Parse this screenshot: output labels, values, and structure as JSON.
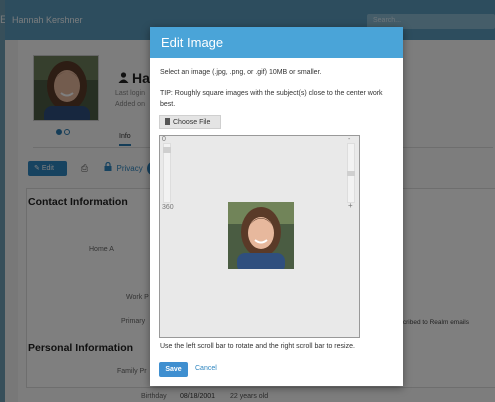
{
  "app": {
    "logo_char": "E",
    "user_name": "Hannah Kershner",
    "search_placeholder": "Search..."
  },
  "profile": {
    "name": "Ha",
    "last_login": "Last login",
    "added_on": "Added on",
    "tabs": [
      {
        "label": "Info",
        "active": true
      }
    ],
    "actions": {
      "edit_label": "Edit",
      "privacy_label": "Privacy"
    }
  },
  "sections": {
    "contact_title": "Contact Information",
    "personal_title": "Personal Information",
    "labels": {
      "home": "Home A",
      "work": "Work P",
      "primary": "Primary",
      "family": "Family Pr",
      "birthday": "Birthday"
    },
    "birthday_value": "08/18/2001",
    "age_value": "22 years old",
    "subscribed_text": "bscribed to Realm emails"
  },
  "modal": {
    "title": "Edit Image",
    "instruction": "Select an image (.jpg, .png, or .gif) 10MB or smaller.",
    "tip": "TIP: Roughly square images with the subject(s) close to the center work best.",
    "choose_file_label": "Choose File",
    "rotation_min": "0",
    "rotation_max": "360",
    "zoom_minus": "-",
    "zoom_plus": "+",
    "help": "Use the left scroll bar to rotate and the right scroll bar to resize.",
    "save_label": "Save",
    "cancel_label": "Cancel",
    "rotation_level": 0.05,
    "zoom_level": 0.5
  },
  "colors": {
    "header_blue": "#5a9bbd",
    "modal_header": "#4aa4d8",
    "primary_button": "#3f8fd0",
    "link": "#2f86c0"
  }
}
